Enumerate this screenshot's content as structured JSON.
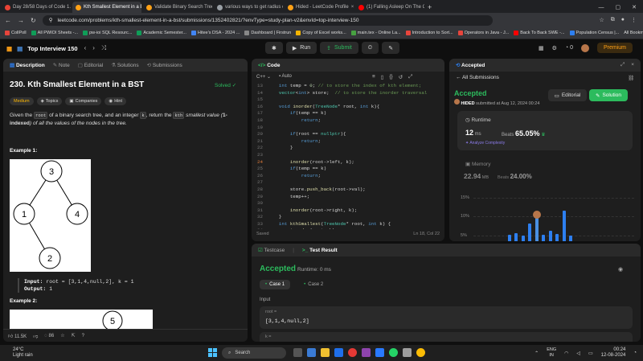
{
  "browser": {
    "tabs": [
      {
        "title": "Day 28/58 Days of Code 1...",
        "color": "#ea4335",
        "active": false
      },
      {
        "title": "Kth Smallest Element in a BST",
        "color": "#ffa116",
        "active": true
      },
      {
        "title": "Validate Binary Search Tree - Le...",
        "color": "#ffa116",
        "active": false
      },
      {
        "title": "various ways to get radius of ...",
        "color": "#9aa0a6",
        "active": false
      },
      {
        "title": "Hided - LeetCode Profile",
        "color": "#ffa116",
        "active": false
      },
      {
        "title": "(1) Falling Asleep On The Couc...",
        "color": "#ff0000",
        "active": false
      }
    ],
    "url": "leetcode.com/problems/kth-smallest-element-in-a-bst/submissions/1352402821/?envType=study-plan-v2&envId=top-interview-150",
    "bookmarks": [
      {
        "label": "CollPoll",
        "color": "#e8453c"
      },
      {
        "label": "All PWIOI Sheets -...",
        "color": "#0f9d58"
      },
      {
        "label": "pw-ioi SQL Resourc...",
        "color": "#0f9d58"
      },
      {
        "label": "Academic Semester...",
        "color": "#0f9d58"
      },
      {
        "label": "Hitee's DSA - 2024 ...",
        "color": "#4285f4"
      },
      {
        "label": "Dashboard | Firstrun",
        "color": "#888888"
      },
      {
        "label": "Copy of Excel works...",
        "color": "#f4b400"
      },
      {
        "label": "main.tex - Online La...",
        "color": "#47a141"
      },
      {
        "label": "Introduction to Sort...",
        "color": "#e8453c"
      },
      {
        "label": "Operators in Java - J...",
        "color": "#e8453c"
      },
      {
        "label": "Back To Back SWE -...",
        "color": "#ff0000"
      },
      {
        "label": "Population Census |...",
        "color": "#2d7ff0"
      }
    ],
    "all_bookmarks": "All Bookmarks"
  },
  "nav": {
    "title": "Top Interview 150",
    "run": "Run",
    "submit": "Submit",
    "streak": "0",
    "premium": "Premium"
  },
  "left": {
    "tabs": [
      "Description",
      "Note",
      "Editorial",
      "Solutions",
      "Submissions"
    ],
    "problem_title": "230. Kth Smallest Element in a BST",
    "solved": "Solved",
    "tags": [
      "Medium",
      "Topics",
      "Companies",
      "Hint"
    ],
    "desc_1": "Given the ",
    "desc_code1": "root",
    "desc_2": " of a binary search tree, and an integer ",
    "desc_code2": "k",
    "desc_3": ", return the ",
    "desc_code3": "kth",
    "desc_4": " smallest value (",
    "desc_bold": "1-indexed",
    "desc_5": ") of all the values of the nodes in the tree.",
    "example1": "Example 1:",
    "tree_nodes": [
      "3",
      "1",
      "4",
      "2"
    ],
    "input_label": "Input:",
    "input_value": " root = [3,1,4,null,2], k = 1",
    "output_label": "Output:",
    "output_value": " 1",
    "example2": "Example 2:",
    "example2_node": "5",
    "likes": "11.5K",
    "comments": "86"
  },
  "code": {
    "title": "Code",
    "language": "C++",
    "mode": "Auto",
    "status_left": "Saved",
    "status_right": "Ln 18, Col 22",
    "lines": [
      {
        "n": "13",
        "t": "    int temp = 0; // to store the index of kth element;"
      },
      {
        "n": "14",
        "t": "    vector<int> store;  // to store the inorder traversal"
      },
      {
        "n": "15",
        "t": ""
      },
      {
        "n": "16",
        "t": "    void inorder(TreeNode* root, int k){"
      },
      {
        "n": "17",
        "t": "        if(temp == k)"
      },
      {
        "n": "18",
        "t": "            return;"
      },
      {
        "n": "19",
        "t": ""
      },
      {
        "n": "20",
        "t": "        if(root == nullptr){"
      },
      {
        "n": "21",
        "t": "            return;"
      },
      {
        "n": "22",
        "t": "        }"
      },
      {
        "n": "23",
        "t": ""
      },
      {
        "n": "24",
        "t": "        inorder(root->left, k);"
      },
      {
        "n": "25",
        "t": "        if(temp == k)"
      },
      {
        "n": "26",
        "t": "            return;"
      },
      {
        "n": "27",
        "t": ""
      },
      {
        "n": "28",
        "t": "        store.push_back(root->val);"
      },
      {
        "n": "29",
        "t": "        temp++;"
      },
      {
        "n": "30",
        "t": ""
      },
      {
        "n": "31",
        "t": "        inorder(root->right, k);"
      },
      {
        "n": "32",
        "t": "    }"
      },
      {
        "n": "33",
        "t": "    int kthSmallest(TreeNode* root, int k) {"
      },
      {
        "n": "34",
        "t": "        inorder(root, k);"
      },
      {
        "n": "35",
        "t": ""
      }
    ]
  },
  "accepted": {
    "tab": "Accepted",
    "back": "All Submissions",
    "title": "Accepted",
    "user": "HIDED",
    "submitted": " submitted at Aug 12, 2024 00:24",
    "editorial": "Editorial",
    "solution": "Solution",
    "runtime_label": "Runtime",
    "runtime": "12",
    "runtime_unit": " ms",
    "beats_label": "Beats ",
    "runtime_beats": "65.05%",
    "analyze": "Analyze Complexity",
    "memory_label": "Memory",
    "memory": "22.94",
    "memory_unit": " MB",
    "memory_beats": "24.00%",
    "yticks": [
      "15%",
      "10%",
      "5%"
    ],
    "bars": [
      0.0,
      0.0,
      0.0,
      0.0,
      0.0,
      0.2,
      0.25,
      0.18,
      0.55,
      0.85,
      0.2,
      0.32,
      0.22,
      0.95,
      0.18
    ]
  },
  "test": {
    "tabs": [
      "Testcase",
      "Test Result"
    ],
    "status": "Accepted",
    "runtime": "Runtime: 0 ms",
    "cases": [
      "Case 1",
      "Case 2"
    ],
    "input_label": "Input",
    "var_root": "root =",
    "root_value": "[3,1,4,null,2]",
    "var_k": "k ="
  },
  "taskbar": {
    "temp": "24°C",
    "weather": "Light rain",
    "search": "Search",
    "lang1": "ENG",
    "lang2": "IN",
    "time": "00:24",
    "date": "12-08-2024"
  }
}
